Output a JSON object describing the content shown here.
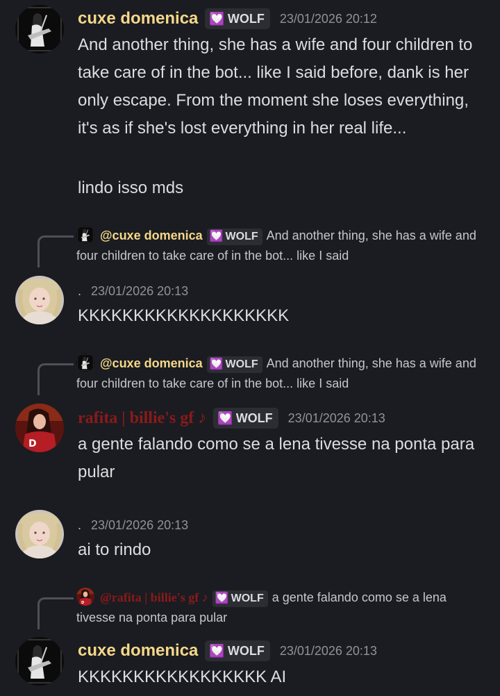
{
  "colors": {
    "background": "#1b1c21",
    "cuxe_name": "#f5d889",
    "rafita_name": "#8b1a1a",
    "role_heart": "#f3b5f0"
  },
  "role": {
    "icon": "heart-icon",
    "label": "WOLF"
  },
  "messages": [
    {
      "username": "cuxe domenica",
      "timestamp": "23/01/2026 20:12",
      "lines": [
        "And another thing, she has a wife and four children to take care of in the bot... like I said before, dank is her only escape. From the moment she loses everything, it's as if she's lost everything in her real life...",
        "lindo isso mds"
      ]
    },
    {
      "reply": {
        "mention": "@cuxe domenica",
        "text": "And another thing, she has a wife and four children to take care of in the bot... like I said"
      },
      "username": ".",
      "timestamp": "23/01/2026 20:13",
      "lines": [
        "KKKKKKKKKKKKKKKKKKK"
      ]
    },
    {
      "reply": {
        "mention": "@cuxe domenica",
        "text": "And another thing, she has a wife and four children to take care of in the bot... like I said"
      },
      "username": "rafita | billie's gf ♪",
      "timestamp": "23/01/2026 20:13",
      "lines": [
        "a gente falando como se a lena tivesse na ponta para pular"
      ]
    },
    {
      "username": ".",
      "timestamp": "23/01/2026 20:13",
      "lines": [
        "ai to rindo"
      ]
    },
    {
      "reply": {
        "mention": "@rafita | billie's gf ♪",
        "text": "a gente falando como se a lena tivesse na ponta para pular"
      },
      "username": "cuxe domenica",
      "timestamp": "23/01/2026 20:13",
      "lines": [
        "KKKKKKKKKKKKKKKKK AI"
      ]
    }
  ]
}
